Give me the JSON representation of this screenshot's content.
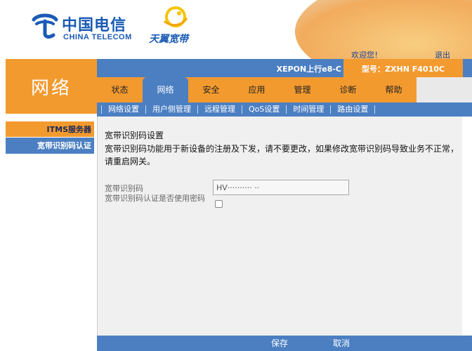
{
  "header": {
    "brand_cn": "中国电信",
    "brand_en": "CHINA TELECOM",
    "sub_brand": "天翼宽带",
    "welcome": "欢迎您！",
    "logout": "退出"
  },
  "device": {
    "label": "XEPON上行e8-C",
    "model": "型号：ZXHN F4010C"
  },
  "section": {
    "title": "网络"
  },
  "main_tabs": [
    {
      "label": "状态"
    },
    {
      "label": "网络"
    },
    {
      "label": "安全"
    },
    {
      "label": "应用"
    },
    {
      "label": "管理"
    },
    {
      "label": "诊断"
    },
    {
      "label": "帮助"
    }
  ],
  "active_main_tab": "网络",
  "sub_nav": [
    {
      "label": "网络设置"
    },
    {
      "label": "用户侧管理"
    },
    {
      "label": "远程管理"
    },
    {
      "label": "QoS设置"
    },
    {
      "label": "时间管理"
    },
    {
      "label": "路由设置"
    }
  ],
  "active_sub_nav": "远程管理",
  "side_nav": [
    {
      "label": "ITMS服务器"
    },
    {
      "label": "宽带识别码认证"
    }
  ],
  "content": {
    "title": "宽带识别码设置",
    "description": "宽带识别码功能用于新设备的注册及下发，请不要更改，如果修改宽带识别码导致业务不正常，请重启网关。",
    "code_label": "宽带识别码",
    "code_value": "HV·········· ··",
    "auth_label": "宽带识别码认证是否使用密码",
    "auth_checked": false
  },
  "buttons": {
    "save": "保存",
    "cancel": "取消"
  },
  "colors": {
    "orange": "#f39a2f",
    "blue": "#4b7fc2",
    "brand_blue": "#1a5bb5"
  }
}
